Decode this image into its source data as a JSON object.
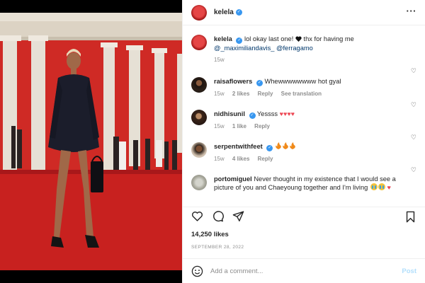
{
  "post": {
    "username": "kelela",
    "caption_text": "lol okay last one!",
    "caption_thanks": "thx for having me",
    "caption_mentions": [
      "@_maximiliandavis_",
      "@ferragamo"
    ],
    "caption_age": "15w",
    "likes": "14,250 likes",
    "date": "SEPTEMBER 28, 2022"
  },
  "header": {
    "more_icon": "more-horizontal-icon"
  },
  "comments": [
    {
      "username": "raisaflowers",
      "verified": true,
      "text": "Whewwwwwwww hot gyal",
      "age": "15w",
      "likes": "2 likes",
      "reply": "Reply",
      "extra": "See translation"
    },
    {
      "username": "nidhisunil",
      "verified": true,
      "text": "Yessss",
      "age": "15w",
      "likes": "1 like",
      "reply": "Reply"
    },
    {
      "username": "serpentwithfeet",
      "verified": true,
      "text": "",
      "age": "15w",
      "likes": "4 likes",
      "reply": "Reply"
    },
    {
      "username": "portomiguel",
      "verified": false,
      "text": "Never thought in my existence that I would see a picture of you and Chaeyoung together and I'm living"
    }
  ],
  "add_comment": {
    "placeholder": "Add a comment...",
    "post_label": "Post"
  },
  "colors": {
    "verified": "#3897f0",
    "link": "#00376b",
    "post_disabled": "#b2dffc",
    "red_carpet": "#c8211f"
  }
}
